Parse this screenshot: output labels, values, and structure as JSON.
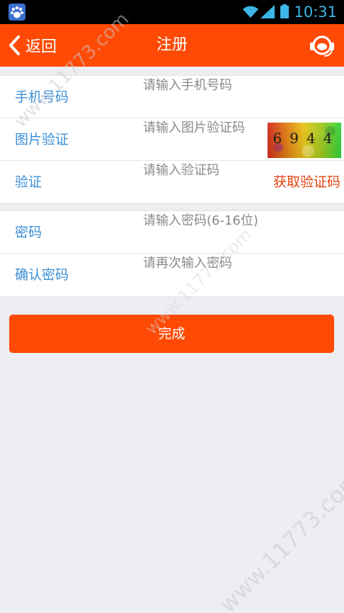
{
  "status_bar": {
    "time": "10:31",
    "app_icon": "baidu-paw-icon",
    "wifi_icon": "wifi-icon",
    "signal_icon": "signal-icon",
    "battery_icon": "battery-icon",
    "accent_color": "#3cb6e6"
  },
  "header": {
    "back_label": "返回",
    "title": "注册",
    "service_icon": "customer-service-icon",
    "background_color": "#ff4a05"
  },
  "form": {
    "phone": {
      "label": "手机号码",
      "placeholder": "请输入手机号码",
      "value": ""
    },
    "image_captcha": {
      "label": "图片验证",
      "placeholder": "请输入图片验证码",
      "value": "",
      "captcha_text": "6944"
    },
    "sms_code": {
      "label": "验证",
      "placeholder": "请输入验证码",
      "value": "",
      "get_code_label": "获取验证码"
    },
    "password": {
      "label": "密码",
      "placeholder": "请输入密码(6-16位)",
      "value": ""
    },
    "confirm_password": {
      "label": "确认密码",
      "placeholder": "请再次输入密码",
      "value": ""
    }
  },
  "submit_label": "完成",
  "watermark_text": "www.11773.com",
  "colors": {
    "label_blue": "#3b8fd6",
    "link_orange": "#e3420f",
    "page_background": "#eeedf2"
  }
}
